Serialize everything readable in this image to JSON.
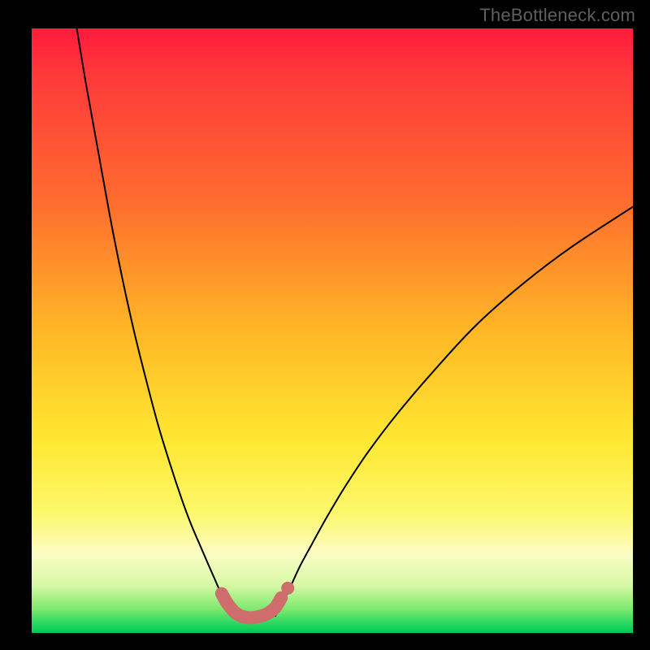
{
  "watermark": "TheBottleneck.com",
  "colors": {
    "frame": "#000000",
    "gradient_top": "#ff1a3c",
    "gradient_mid": "#ffe732",
    "gradient_bottom": "#00c853",
    "curve": "#000000",
    "valley_highlight": "#cf6d6d"
  },
  "chart_data": {
    "type": "line",
    "title": "",
    "xlabel": "",
    "ylabel": "",
    "xlim": [
      0,
      100
    ],
    "ylim": [
      0,
      100
    ],
    "grid": false,
    "note": "No numeric axis/tick labels are visible. x/y are expressed as 0–100 percent of the plot area; y=0 is top, y=100 is bottom. Values are read from pixel positions.",
    "series": [
      {
        "name": "left-branch",
        "x": [
          7.5,
          9,
          11,
          13,
          15,
          17,
          19,
          21,
          23,
          25,
          26.5,
          28,
          29.3,
          30.4,
          31.3,
          32.1,
          33.6,
          35.1
        ],
        "y": [
          0,
          9,
          20,
          31,
          41,
          50,
          58,
          65.5,
          72,
          78,
          82,
          85.5,
          88.5,
          91,
          93,
          94.5,
          96.2,
          97.2
        ]
      },
      {
        "name": "right-branch",
        "x": [
          40.5,
          41.2,
          42.1,
          43.2,
          44.6,
          46.5,
          49,
          52,
          56,
          61,
          67,
          74,
          82,
          90,
          100
        ],
        "y": [
          97.2,
          96,
          94.3,
          92,
          89,
          85.5,
          81,
          76,
          70,
          63.5,
          56.5,
          49,
          42,
          36,
          29.5
        ]
      },
      {
        "name": "valley-highlight",
        "x": [
          31.6,
          32.6,
          33.8,
          35.1,
          36.5,
          37.8,
          39.2,
          40.5,
          41.5
        ],
        "y": [
          93.5,
          95.2,
          96.6,
          97.3,
          97.5,
          97.3,
          96.8,
          95.8,
          94.2
        ]
      }
    ],
    "marker": {
      "name": "valley-extra-dot",
      "x": 42.6,
      "y": 92.6
    }
  }
}
